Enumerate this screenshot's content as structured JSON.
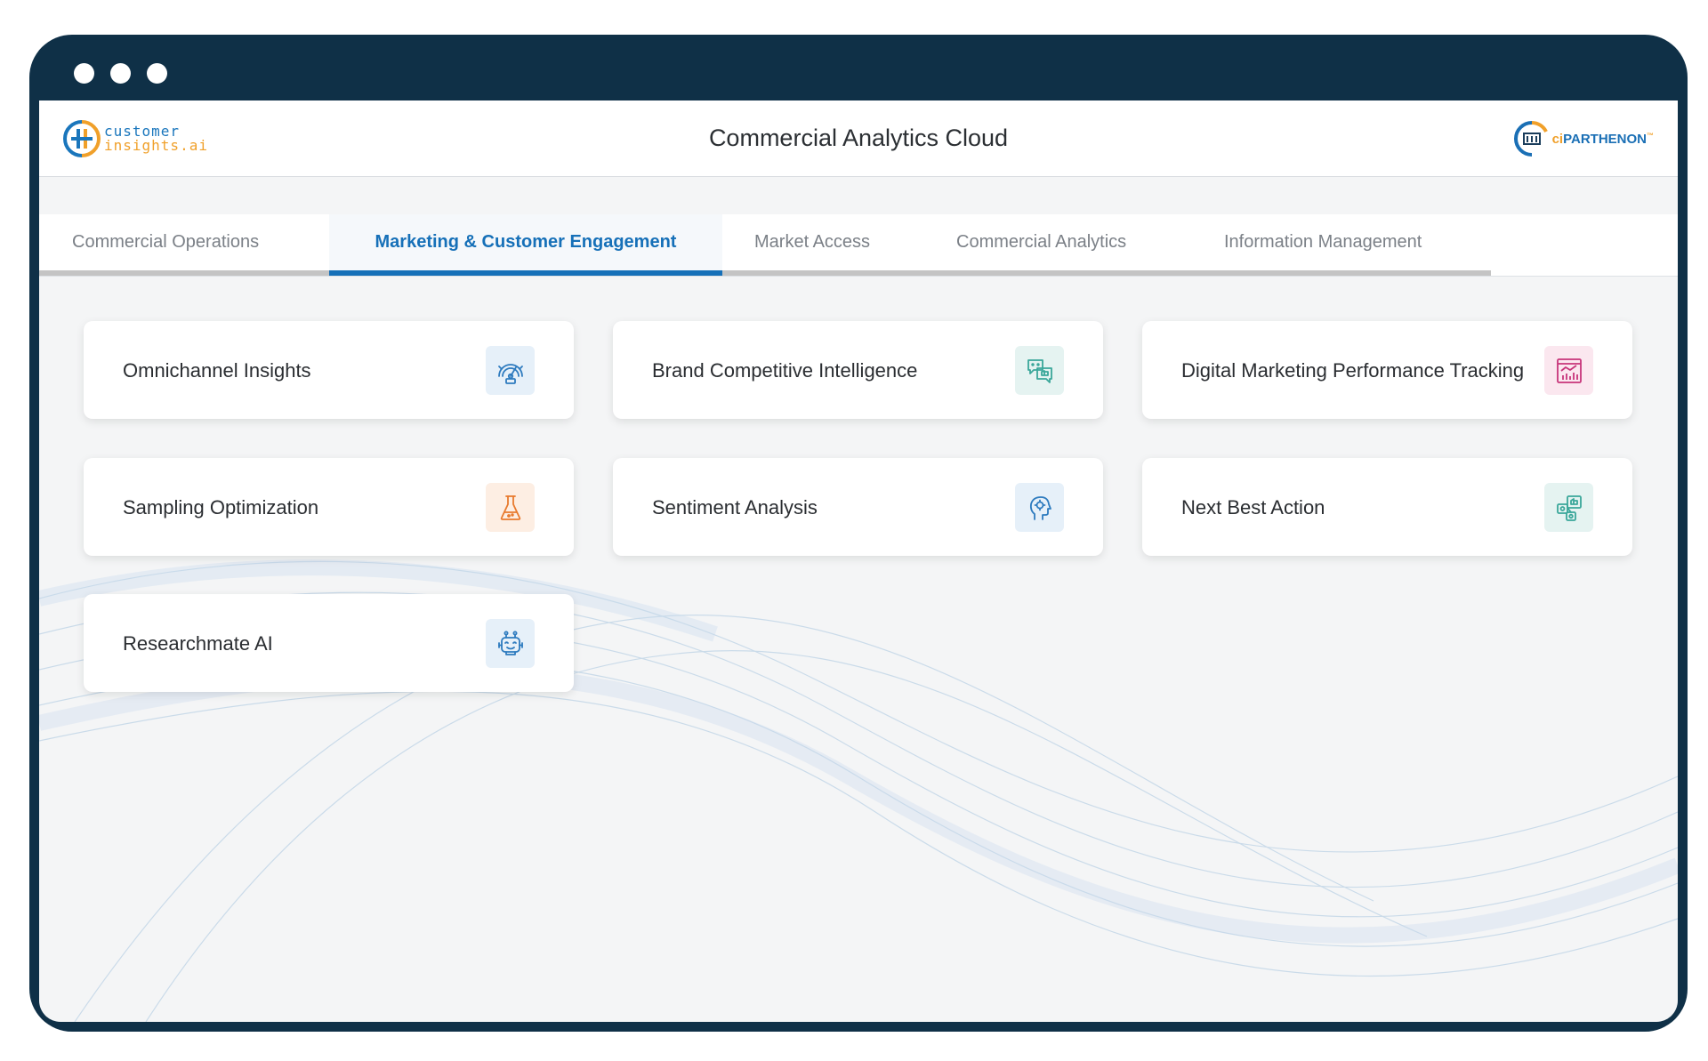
{
  "app": {
    "title": "Commercial Analytics Cloud",
    "logo_left": {
      "line1": "customer",
      "line2": "insights.ai"
    },
    "logo_right": {
      "prefix": "ci",
      "name": "PARTHENON",
      "tm": "™"
    }
  },
  "tabs": [
    {
      "label": "Commercial Operations",
      "active": false
    },
    {
      "label": "Marketing & Customer Engagement",
      "active": true
    },
    {
      "label": "Market Access",
      "active": false
    },
    {
      "label": "Commercial Analytics",
      "active": false
    },
    {
      "label": "Information Management",
      "active": false
    }
  ],
  "cards": [
    {
      "label": "Omnichannel Insights",
      "icon": "gauge-icon",
      "icon_color": "#2e7bbf",
      "icon_bg": "#e6f0f9"
    },
    {
      "label": "Brand Competitive Intelligence",
      "icon": "chat-bubbles-icon",
      "icon_color": "#3aa79a",
      "icon_bg": "#e5f3f1"
    },
    {
      "label": "Digital Marketing Performance Tracking",
      "icon": "chart-board-icon",
      "icon_color": "#c7357a",
      "icon_bg": "#fbe7ef"
    },
    {
      "label": "Sampling Optimization",
      "icon": "flask-icon",
      "icon_color": "#e87a2e",
      "icon_bg": "#fdeee3"
    },
    {
      "label": "Sentiment Analysis",
      "icon": "head-gears-icon",
      "icon_color": "#2e7bbf",
      "icon_bg": "#e6f0f9"
    },
    {
      "label": "Next Best Action",
      "icon": "like-network-icon",
      "icon_color": "#3aa79a",
      "icon_bg": "#e5f3f1"
    },
    {
      "label": "Researchmate AI",
      "icon": "robot-icon",
      "icon_color": "#2e7bbf",
      "icon_bg": "#e6f0f9"
    }
  ],
  "colors": {
    "frame": "#0f3047",
    "accent": "#1670b8",
    "tab_inactive": "#7b8087"
  }
}
